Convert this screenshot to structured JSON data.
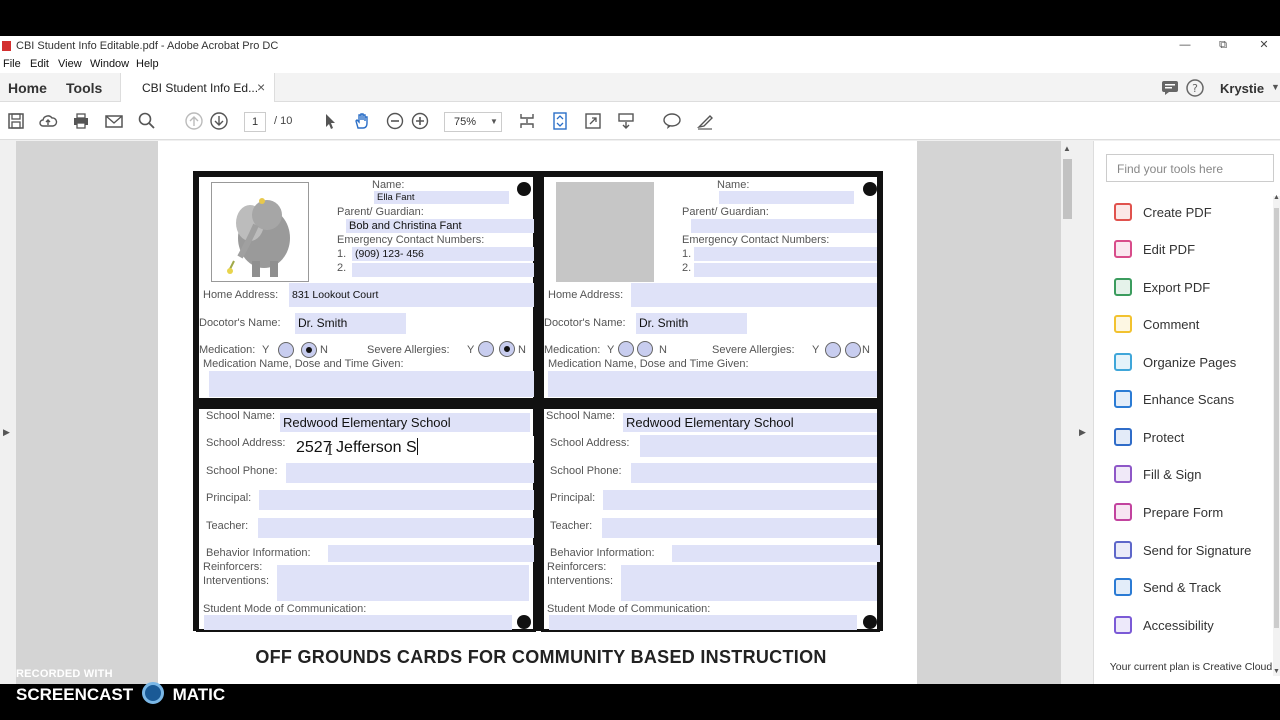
{
  "window": {
    "title": "CBI Student Info Editable.pdf - Adobe Acrobat Pro DC",
    "minimize": "—",
    "maximize": "⧉",
    "close": "✕"
  },
  "menu": [
    "File",
    "Edit",
    "View",
    "Window",
    "Help"
  ],
  "tabs": {
    "home": "Home",
    "tools": "Tools",
    "doc": "CBI Student Info Ed...",
    "close": "×",
    "user": "Krystie"
  },
  "toolbar": {
    "page_current": "1",
    "page_total": "/ 10",
    "zoom": "75%"
  },
  "card1": {
    "labels": {
      "name": "Name:",
      "guardian": "Parent/ Guardian:",
      "emergency": "Emergency Contact Numbers:",
      "num1": "1.",
      "num2": "2.",
      "home_address": "Home Address:",
      "doctor": "Docotor's Name:",
      "medication": "Medication:",
      "med_y": "Y",
      "med_n": "N",
      "allergies": "Severe Allergies:",
      "allergy_y": "Y",
      "allergy_n": "N",
      "med_details": "Medication Name, Dose and Time Given:"
    },
    "values": {
      "name": "Ella Fant",
      "guardian": "Bob and Christina Fant",
      "phone1": "(909) 123- 456",
      "phone2": "",
      "home_address": "831 Lookout Court",
      "doctor": "Dr. Smith"
    }
  },
  "card2": {
    "labels": {
      "name": "Name:",
      "guardian": "Parent/ Guardian:",
      "emergency": "Emergency Contact Numbers:",
      "num1": "1.",
      "num2": "2.",
      "home_address": "Home Address:",
      "doctor": "Docotor's Name:",
      "medication": "Medication:",
      "med_y": "Y",
      "med_n": "N",
      "allergies": "Severe Allergies:",
      "allergy_y": "Y",
      "allergy_n": "N",
      "med_details": "Medication Name, Dose and Time Given:"
    },
    "values": {
      "doctor": "Dr. Smith"
    }
  },
  "card3": {
    "labels": {
      "school_name": "School Name:",
      "school_address": "School Address:",
      "school_phone": "School Phone:",
      "principal": "Principal:",
      "teacher": "Teacher:",
      "behavior": "Behavior Information:",
      "reinforcers": "Reinforcers:",
      "interventions": "Interventions:",
      "mode": "Student Mode of Communication:"
    },
    "values": {
      "school_name": "Redwood Elementary School",
      "school_address": "2527 Jefferson S"
    }
  },
  "card4": {
    "labels": {
      "school_name": "School Name:",
      "school_address": "School Address:",
      "school_phone": "School Phone:",
      "principal": "Principal:",
      "teacher": "Teacher:",
      "behavior": "Behavior Information:",
      "reinforcers": "Reinforcers:",
      "interventions": "Interventions:",
      "mode": "Student Mode of Communication:"
    },
    "values": {
      "school_name": "Redwood Elementary School"
    }
  },
  "banner": "OFF GROUNDS CARDS FOR COMMUNITY BASED INSTRUCTION",
  "right_panel": {
    "search_placeholder": "Find your tools here",
    "tools": [
      {
        "label": "Create PDF",
        "color": "#e0524d"
      },
      {
        "label": "Edit PDF",
        "color": "#d84c8a"
      },
      {
        "label": "Export PDF",
        "color": "#3b9c5e"
      },
      {
        "label": "Comment",
        "color": "#f2c22f"
      },
      {
        "label": "Organize Pages",
        "color": "#3fa6d9"
      },
      {
        "label": "Enhance Scans",
        "color": "#2b7bd4"
      },
      {
        "label": "Protect",
        "color": "#2f6cc8"
      },
      {
        "label": "Fill & Sign",
        "color": "#8e57c7"
      },
      {
        "label": "Prepare Form",
        "color": "#c2439e"
      },
      {
        "label": "Send for Signature",
        "color": "#5e67c9"
      },
      {
        "label": "Send & Track",
        "color": "#2b7bd4"
      },
      {
        "label": "Accessibility",
        "color": "#7b5ad6"
      }
    ],
    "plan": "Your current plan is Creative Cloud"
  },
  "watermark": {
    "line1": "RECORDED WITH",
    "line2a": "SCREENCAST",
    "line2b": "MATIC"
  }
}
